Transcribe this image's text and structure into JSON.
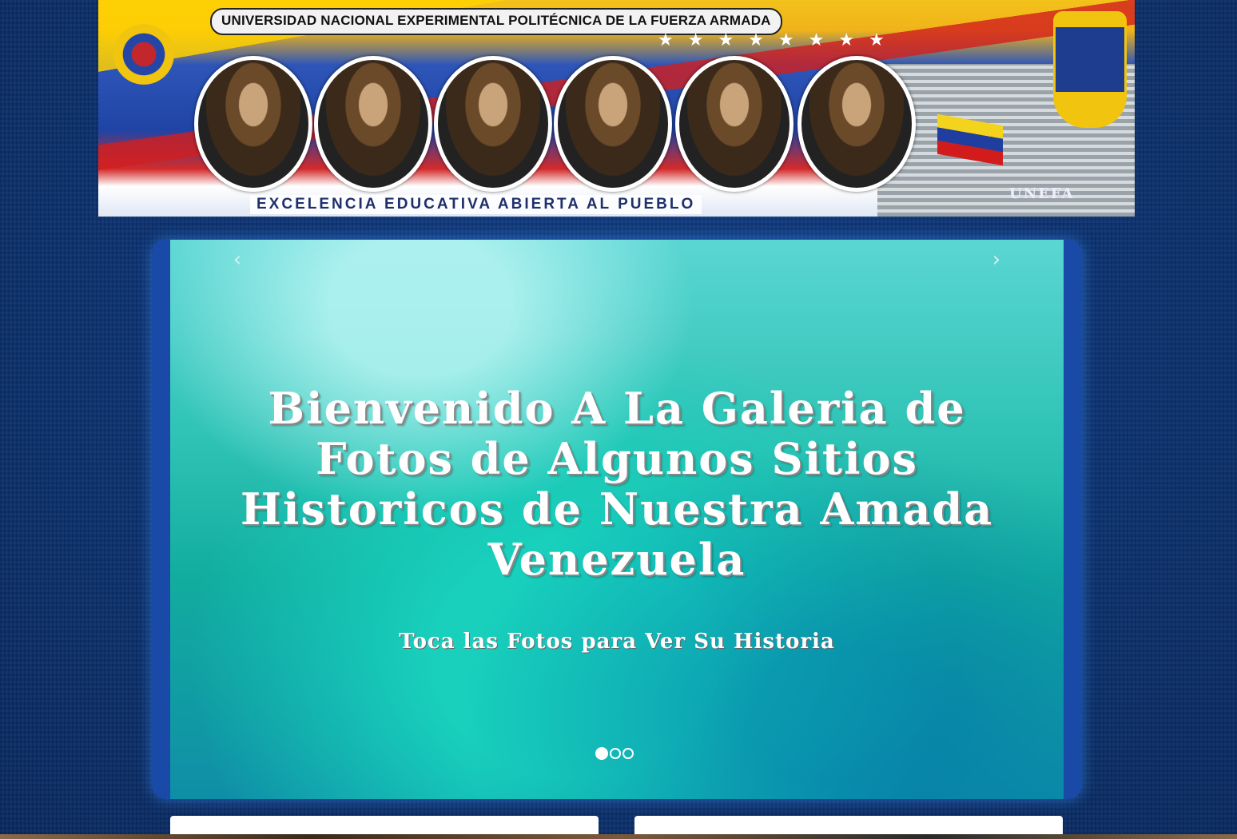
{
  "banner": {
    "title": "UNIVERSIDAD NACIONAL EXPERIMENTAL POLITÉCNICA DE LA FUERZA ARMADA",
    "slogan": "EXCELENCIA EDUCATIVA ABIERTA AL PUEBLO",
    "building_label": "UNEFA",
    "stars": "★★★★★★★★",
    "portraits": [
      "portrait-1",
      "portrait-2",
      "portrait-3",
      "portrait-4",
      "portrait-5",
      "portrait-6"
    ]
  },
  "carousel": {
    "prev_label": "‹",
    "next_label": "›",
    "slide_title": "Bienvenido A La Galeria de Fotos de Algunos Sitios Historicos de Nuestra Amada Venezuela",
    "slide_subtitle": "Toca las Fotos para Ver Su Historia",
    "slide_count": 3,
    "active_slide": 1
  },
  "colors": {
    "page_bg": "#0d3372",
    "frame": "#1a4aa8",
    "slide_teal": "#12ad9f",
    "text": "#ffffff"
  }
}
